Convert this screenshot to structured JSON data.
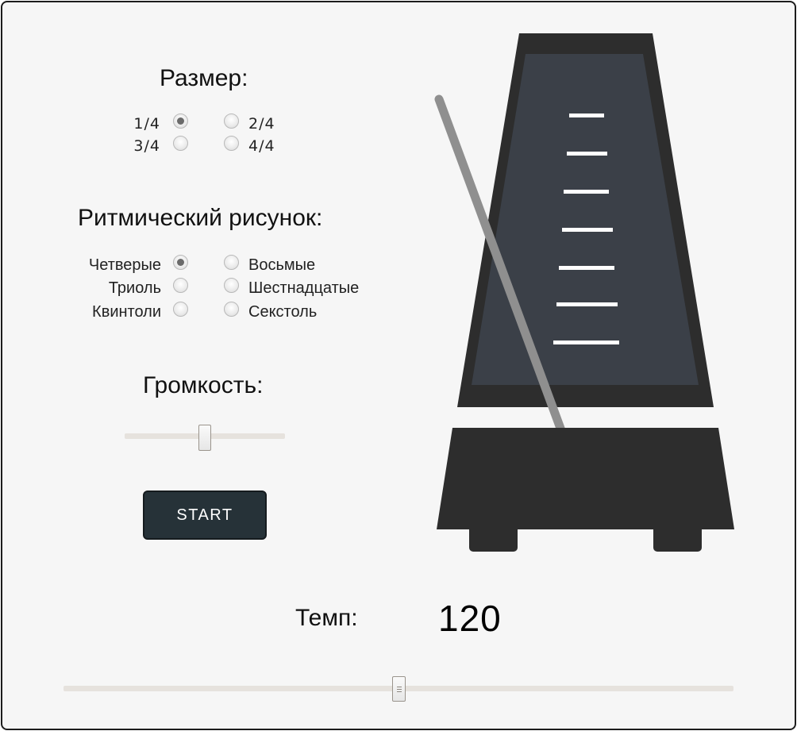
{
  "time_signature": {
    "title": "Размер:",
    "options": [
      {
        "label": "1/4",
        "checked": true
      },
      {
        "label": "2/4",
        "checked": false
      },
      {
        "label": "3/4",
        "checked": false
      },
      {
        "label": "4/4",
        "checked": false
      }
    ]
  },
  "rhythm": {
    "title": "Ритмический рисунок:",
    "options": [
      {
        "label": "Четверые",
        "checked": true
      },
      {
        "label": "Восьмые",
        "checked": false
      },
      {
        "label": "Триоль",
        "checked": false
      },
      {
        "label": "Шестнадцатые",
        "checked": false
      },
      {
        "label": "Квинтоли",
        "checked": false
      },
      {
        "label": "Секстоль",
        "checked": false
      }
    ]
  },
  "volume": {
    "title": "Громкость:",
    "value_fraction": 0.5
  },
  "start_button": {
    "label": "START"
  },
  "tempo": {
    "label": "Темп:",
    "value": "120",
    "slider_fraction": 0.5
  },
  "colors": {
    "frame_border": "#1c1c1c",
    "background": "#f6f6f6",
    "button_bg": "#263238",
    "metronome_body": "#2d2d2d",
    "metronome_face": "#3b4048",
    "pendulum": "#8f8f8f"
  }
}
